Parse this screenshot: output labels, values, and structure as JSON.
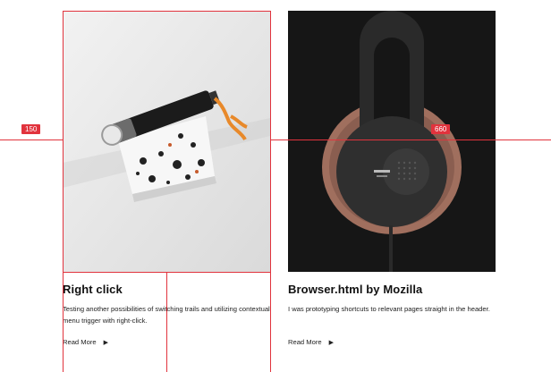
{
  "cards": [
    {
      "title": "Right click",
      "description": "Testing another possibilities of switching trails and utilizing contextual menu trigger with right-click.",
      "read_more": "Read More"
    },
    {
      "title": "Browser.html by Mozilla",
      "description": "I was prototyping shortcuts to relevant pages straight in the header.",
      "read_more": "Read More"
    }
  ],
  "guides": {
    "left_marker": "150",
    "right_marker": "660"
  },
  "icons": {
    "read_more_arrow": "play-right-icon"
  },
  "colors": {
    "guide_red": "#e1333d",
    "dark_card_bg": "#1c1c1c"
  }
}
